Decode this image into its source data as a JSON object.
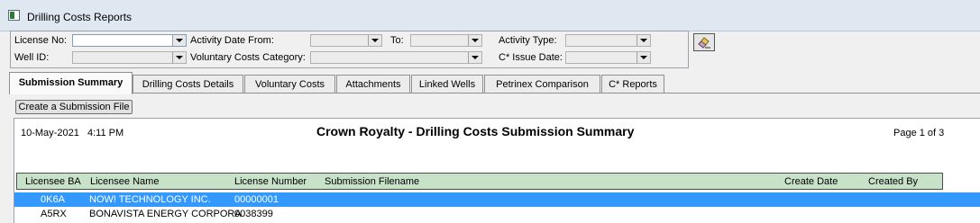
{
  "window": {
    "title": "Drilling Costs Reports"
  },
  "filters": {
    "license_no_label": "License No:",
    "well_id_label": "Well ID:",
    "activity_date_from_label": "Activity Date From:",
    "to_label": "To:",
    "voluntary_costs_category_label": "Voluntary Costs Category:",
    "activity_type_label": "Activity Type:",
    "c_issue_date_label": "C* Issue Date:"
  },
  "tabs": [
    {
      "label": "Submission Summary",
      "active": true
    },
    {
      "label": "Drilling Costs Details"
    },
    {
      "label": "Voluntary Costs"
    },
    {
      "label": "Attachments"
    },
    {
      "label": "Linked Wells"
    },
    {
      "label": "Petrinex Comparison"
    },
    {
      "label": "C* Reports"
    }
  ],
  "toolbar": {
    "create_label": "Create a Submission File"
  },
  "report": {
    "date": "10-May-2021",
    "time": "4:11 PM",
    "title": "Crown Royalty - Drilling Costs Submission Summary",
    "page": "Page 1 of 3",
    "columns": {
      "licensee_ba": "Licensee BA",
      "licensee_name": "Licensee Name",
      "license_number": "License Number",
      "submission_filename": "Submission Filename",
      "create_date": "Create Date",
      "created_by": "Created By"
    },
    "rows": [
      {
        "ba": "0K6A",
        "name": "NOW! TECHNOLOGY INC.",
        "license": "00000001",
        "selected": true
      },
      {
        "ba": "A5RX",
        "name": "BONAVISTA ENERGY CORPORA",
        "license": "0038399",
        "selected": false
      }
    ]
  },
  "colors": {
    "selection": "#3399ff",
    "header_bg": "#c8e2c9"
  }
}
